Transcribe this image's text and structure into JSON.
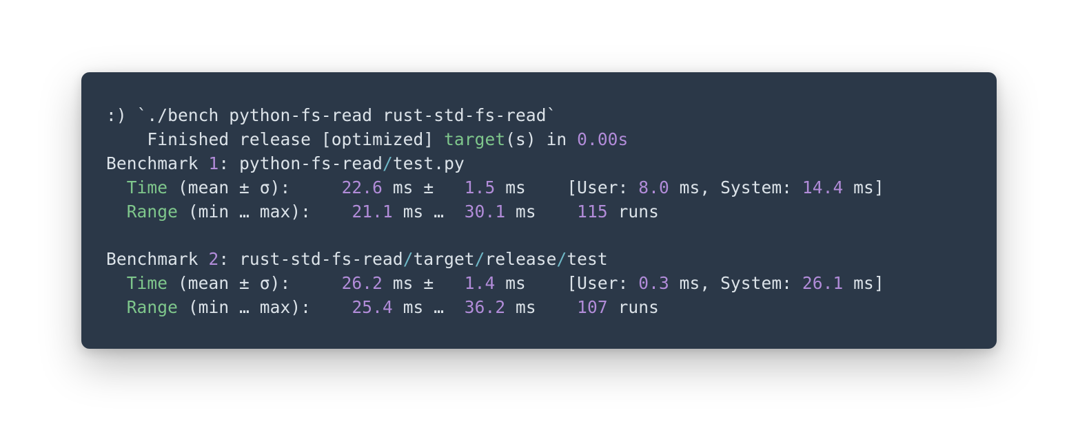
{
  "prompt": ":) ",
  "command": "`./bench python-fs-read rust-std-fs-read`",
  "compile": {
    "prefix": "    Finished release [optimized] ",
    "target_word": "target",
    "paren_s_in": "(s) in ",
    "duration": "0.00s"
  },
  "bench1": {
    "header_prefix": "Benchmark ",
    "header_num": "1",
    "header_sep": ": ",
    "path_seg1": "python-fs-read",
    "path_slash": "/",
    "path_seg2": "test.py",
    "time_label": "Time",
    "time_stat": " (mean ± σ):     ",
    "mean": "22.6",
    "ms_pm": " ms ±   ",
    "sigma": "1.5",
    "ms_gap": " ms    ",
    "bracket_open": "[User: ",
    "user": "8.0",
    "ms_comma": " ms, System: ",
    "sys": "14.4",
    "ms_close": " ms]",
    "range_label": "Range",
    "range_stat": " (min … max):    ",
    "min": "21.1",
    "ms_ell": " ms …  ",
    "max": "30.1",
    "ms_gap2": " ms    ",
    "runs": "115",
    "runs_word": " runs"
  },
  "bench2": {
    "header_prefix": "Benchmark ",
    "header_num": "2",
    "header_sep": ": ",
    "path_seg1": "rust-std-fs-read",
    "path_seg2": "target",
    "path_seg3": "release",
    "path_seg4": "test",
    "path_slash": "/",
    "time_label": "Time",
    "time_stat": " (mean ± σ):     ",
    "mean": "26.2",
    "ms_pm": " ms ±   ",
    "sigma": "1.4",
    "ms_gap": " ms    ",
    "bracket_open": "[User: ",
    "user": "0.3",
    "ms_comma": " ms, System: ",
    "sys": "26.1",
    "ms_close": " ms]",
    "range_label": "Range",
    "range_stat": " (min … max):    ",
    "min": "25.4",
    "ms_ell": " ms …  ",
    "max": "36.2",
    "ms_gap2": " ms    ",
    "runs": "107",
    "runs_word": " runs"
  }
}
